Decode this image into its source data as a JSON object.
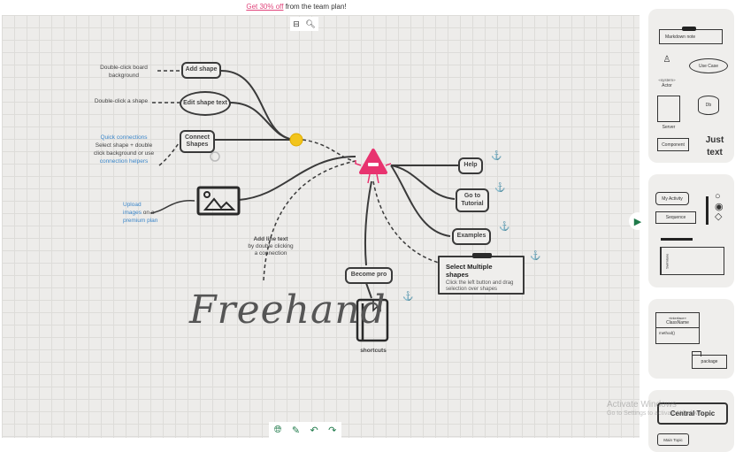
{
  "promo": {
    "link": "Get 30% off",
    "rest": " from the team plan!"
  },
  "zoom_controls": {
    "fit_icon": "fit-screen-icon",
    "zoom_icon": "magnifier-icon"
  },
  "nodes": {
    "add_shape": "Add shape",
    "edit_shape_text": "Edit shape text",
    "connect_shapes": "Connect Shapes",
    "help": "Help",
    "go_to_tutorial": "Go to Tutorial",
    "examples": "Examples",
    "become_pro": "Become pro",
    "shortcuts": "shortcuts",
    "select_multiple_title": "Select Multiple shapes",
    "select_multiple_body": "Click the left button and drag selection over shapes"
  },
  "notes": {
    "double_click_board": "Double-click board background",
    "double_click_shape": "Double-click a shape",
    "quick_connections_link": "Quick connections",
    "quick_connections_body": "Select shape + double click background or use",
    "connection_helpers_link": "connection helpers",
    "upload_link": "Upload images",
    "upload_mid": " on a ",
    "premium_link": "premium plan",
    "add_line_text_title": "Add line text",
    "add_line_text_body": "by double clicking a connection",
    "freehand": "Freehand"
  },
  "bottom_toolbar": [
    "globe-icon",
    "pencil-icon",
    "undo-icon",
    "redo-icon"
  ],
  "sidebar": {
    "card1": {
      "markdown_note": "Markdown note",
      "actor_stereotype": "«system»",
      "actor": "Actor",
      "use_case": "Use Case",
      "server": "Server",
      "db": "Db",
      "component": "Component",
      "just_text": "Just text"
    },
    "card2": {
      "my_activity": "My Activity",
      "sequence": "Sequence",
      "swimlane": "Swimlane"
    },
    "card3": {
      "interface_stereotype": "«interface»",
      "class_name": "ClassName",
      "method": "method()",
      "package": "package"
    },
    "card4": {
      "central_topic": "Central Topic",
      "main_topic": "Main Topic"
    }
  },
  "watermark": {
    "title": "Activate Windows",
    "subtitle": "Go to Settings to activate Windows."
  },
  "colors": {
    "accent_green": "#1f7a4a",
    "mascot_pink": "#e8336f",
    "hub_yellow": "#f2c41b",
    "link_blue": "#3b86c9",
    "promo_pink": "#e0457b"
  }
}
